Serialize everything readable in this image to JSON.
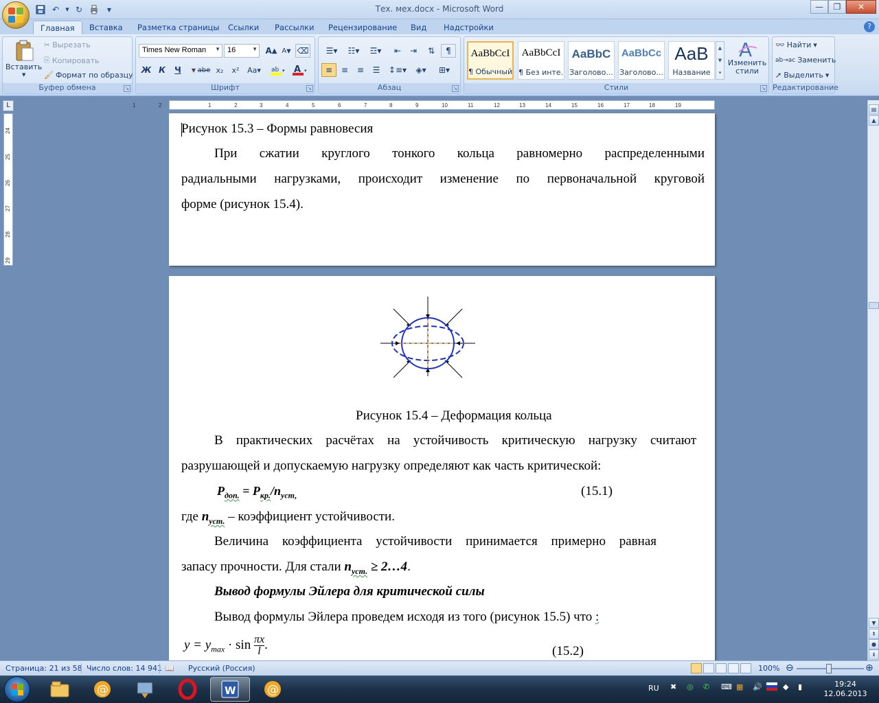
{
  "window": {
    "title": "Тех. мех.docx - Microsoft Word"
  },
  "tabs": [
    "Главная",
    "Вставка",
    "Разметка страницы",
    "Ссылки",
    "Рассылки",
    "Рецензирование",
    "Вид",
    "Надстройки"
  ],
  "clipboard": {
    "paste": "Вставить",
    "cut": "Вырезать",
    "copy": "Копировать",
    "format_painter": "Формат по образцу",
    "label": "Буфер обмена"
  },
  "font": {
    "name": "Times New Roman",
    "size": "16",
    "label": "Шрифт",
    "bold": "Ж",
    "italic": "К",
    "underline": "Ч",
    "strike": "abe",
    "sub": "x₂",
    "sup": "x²",
    "case": "Aa",
    "grow": "A",
    "shrink": "A"
  },
  "paragraph": {
    "label": "Абзац"
  },
  "styles": {
    "label": "Стили",
    "change": "Изменить стили",
    "items": [
      {
        "sample": "AaBbCcI",
        "name": "¶ Обычный"
      },
      {
        "sample": "AaBbCcI",
        "name": "¶ Без инте..."
      },
      {
        "sample": "AaBbC",
        "name": "Заголово..."
      },
      {
        "sample": "AaBbCc",
        "name": "Заголово..."
      },
      {
        "sample": "AaB",
        "name": "Название"
      }
    ]
  },
  "editing": {
    "label": "Редактирование",
    "find": "Найти",
    "replace": "Заменить",
    "select": "Выделить"
  },
  "ruler": {
    "h_ticks": [
      "1",
      "2",
      "1",
      "2",
      "3",
      "4",
      "5",
      "6",
      "7",
      "8",
      "9",
      "10",
      "11",
      "12",
      "13",
      "14",
      "15",
      "16",
      "17",
      "18",
      "19"
    ],
    "v_ticks": [
      "24",
      "25",
      "26",
      "27",
      "28",
      "29"
    ]
  },
  "page1": {
    "caption": "Рисунок 15.3 – Формы равновесия",
    "p1_l1": "При сжатии круглого тонкого кольца равномерно распределенными",
    "p1_l2": "радиальными нагрузками, происходит изменение по первоначальной круговой",
    "p1_l3": "форме (рисунок 15.4)."
  },
  "page2": {
    "caption": "Рисунок 15.4 – Деформация кольца",
    "p1_l1": "В практических расчётах на устойчивость критическую нагрузку считают",
    "p1_l2": "разрушающей и допускаемую нагрузку определяют как часть критической:",
    "formula1": {
      "p": "P",
      "p_sub": "доп.",
      "eq": " = ",
      "pk": "P",
      "pk_sub": "кр.",
      "slash": "/",
      "n": "n",
      "n_sub": "уст,",
      "num": "(15.1)"
    },
    "where": {
      "pre": "где ",
      "n": "n",
      "n_sub": "уст.",
      "post": " – коэффициент  устойчивости."
    },
    "p2_l1": "Величина коэффициента устойчивости  принимается примерно равная",
    "p2_l2_pre": "запасу прочности. Для стали   ",
    "p2_n": "n",
    "p2_n_sub": "уст.",
    "p2_l2_post": " ≥ 2…4",
    "p2_dot": ".",
    "heading": "Вывод формулы Эйлера для критической силы",
    "p3_pre": "Вывод формулы Эйлера  проведем исходя из того (рисунок 15.5) что ",
    "p3_colon": ":",
    "formula2": {
      "lhs": "y = y",
      "sub": "max",
      "mid": " · sin ",
      "frac_num": "πx",
      "frac_den": "l",
      "dot": ".",
      "num": "(15.2)"
    }
  },
  "status": {
    "page": "Страница: 21 из 58",
    "words": "Число слов: 14 941",
    "lang": "Русский (Россия)",
    "zoom": "100%"
  },
  "taskbar": {
    "lang": "RU",
    "time": "19:24",
    "date": "12.06.2013"
  },
  "colors": {
    "ring_blue": "#1a2fd6",
    "axis_orange": "#e07a10"
  }
}
